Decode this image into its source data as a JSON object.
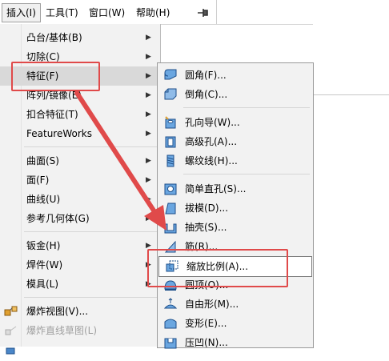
{
  "menubar": {
    "items": [
      {
        "label": "插入(I)"
      },
      {
        "label": "工具(T)"
      },
      {
        "label": "窗口(W)"
      },
      {
        "label": "帮助(H)"
      }
    ],
    "pin_icon": "pin-icon"
  },
  "main_menu": {
    "items": [
      {
        "label": "凸台/基体(B)"
      },
      {
        "label": "切除(C)"
      },
      {
        "label": "特征(F)"
      },
      {
        "label": "阵列/镜像(E)"
      },
      {
        "label": "扣合特征(T)"
      },
      {
        "label": "FeatureWorks"
      },
      {
        "label": "曲面(S)"
      },
      {
        "label": "面(F)"
      },
      {
        "label": "曲线(U)"
      },
      {
        "label": "参考几何体(G)"
      },
      {
        "label": "钣金(H)"
      },
      {
        "label": "焊件(W)"
      },
      {
        "label": "模具(L)"
      },
      {
        "label": "爆炸视图(V)..."
      },
      {
        "label": "爆炸直线草图(L)"
      }
    ]
  },
  "sub_menu": {
    "items": [
      {
        "label": "圆角(F)...",
        "icon": "fillet-icon"
      },
      {
        "label": "倒角(C)...",
        "icon": "chamfer-icon"
      },
      {
        "label": "孔向导(W)...",
        "icon": "hole-wizard-icon"
      },
      {
        "label": "高级孔(A)...",
        "icon": "advanced-hole-icon"
      },
      {
        "label": "螺纹线(H)...",
        "icon": "thread-icon"
      },
      {
        "label": "简单直孔(S)...",
        "icon": "simple-hole-icon"
      },
      {
        "label": "拔模(D)...",
        "icon": "draft-icon"
      },
      {
        "label": "抽壳(S)...",
        "icon": "shell-icon"
      },
      {
        "label": "筋(R)...",
        "icon": "rib-icon"
      },
      {
        "label": "缩放比例(A)...",
        "icon": "scale-icon"
      },
      {
        "label": "圆顶(O)...",
        "icon": "dome-icon"
      },
      {
        "label": "自由形(M)...",
        "icon": "freeform-icon"
      },
      {
        "label": "变形(E)...",
        "icon": "deform-icon"
      },
      {
        "label": "压凹(N)...",
        "icon": "indent-icon"
      }
    ]
  },
  "colors": {
    "annotation_red": "#e04a4a",
    "menu_bg": "#f2f2f2",
    "icon_blue": "#3a7bc8"
  }
}
